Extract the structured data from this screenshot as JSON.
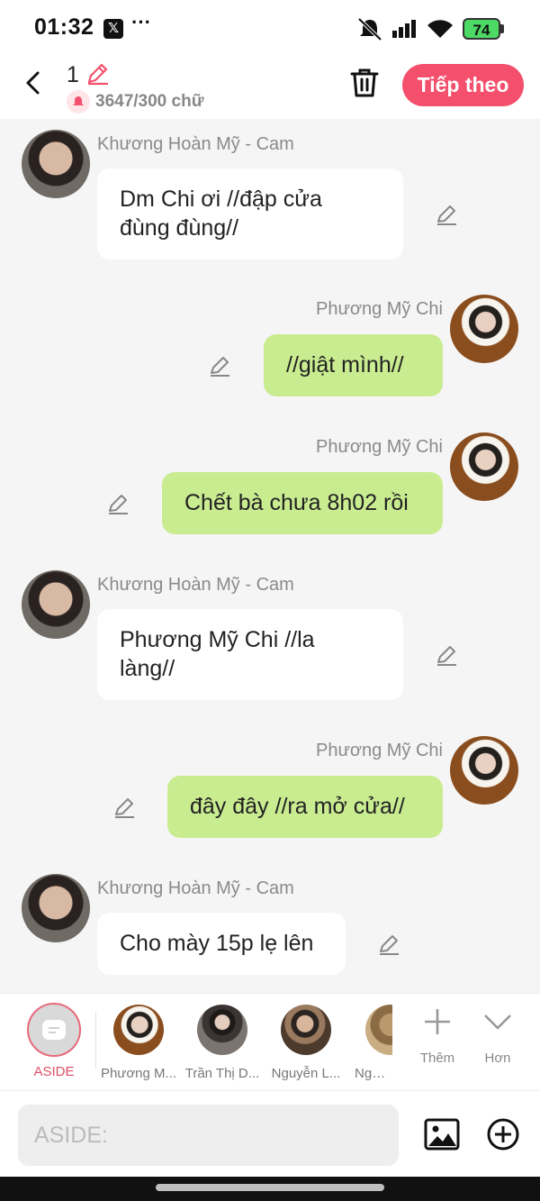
{
  "status_bar": {
    "time": "01:32",
    "x_app": "𝕏",
    "more": "···",
    "battery": "74"
  },
  "header": {
    "title_number": "1",
    "char_count": "3647/300 chữ",
    "next_label": "Tiếp theo"
  },
  "messages": [
    {
      "sender": "Khương Hoàn Mỹ - Cam",
      "side": "left",
      "line1": "Dm Chi ơi //đập cửa",
      "line2": "đùng đùng//"
    },
    {
      "sender": "Phương Mỹ Chi",
      "side": "right",
      "line1": "//giật mình//"
    },
    {
      "sender": "Phương Mỹ Chi",
      "side": "right",
      "line1": "Chết bà chưa 8h02 rồi"
    },
    {
      "sender": "Khương Hoàn Mỹ - Cam",
      "side": "left",
      "line1": "Phương Mỹ Chi //la",
      "line2": "làng//"
    },
    {
      "sender": "Phương Mỹ Chi",
      "side": "right",
      "line1": "đây đây //ra mở cửa//"
    },
    {
      "sender": "Khương Hoàn Mỹ - Cam",
      "side": "left",
      "line1": "Cho mày 15p lẹ lên"
    }
  ],
  "toolbar": {
    "aside_label": "ASIDE",
    "characters": [
      "Phương M...",
      "Trần Thị D...",
      "Nguyễn L...",
      "Nguyễ"
    ],
    "add_label": "Thêm",
    "more_label": "Hơn"
  },
  "composer": {
    "placeholder": "ASIDE:"
  },
  "colors": {
    "accent": "#f4506d",
    "bubble_right": "#c9ec91",
    "bubble_left": "#ffffff",
    "background": "#f5f5f5"
  }
}
